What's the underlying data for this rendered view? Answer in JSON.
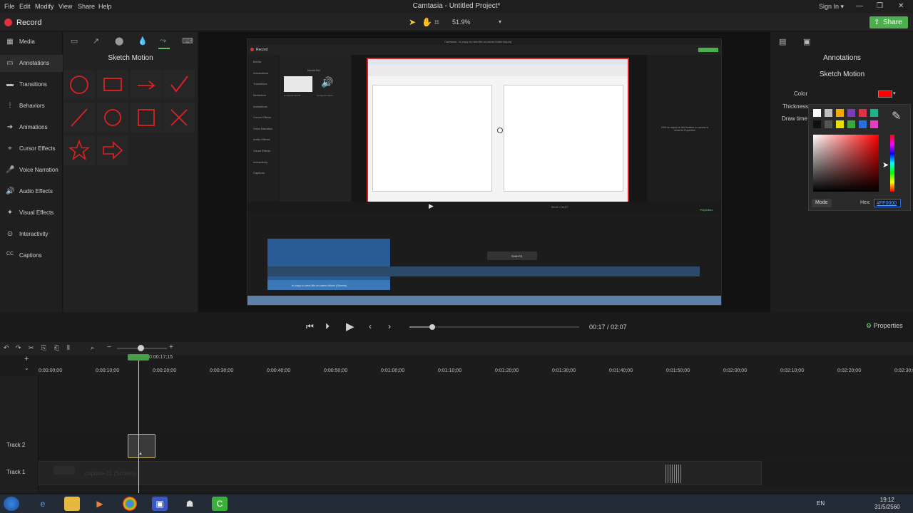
{
  "menu": [
    "File",
    "Edit",
    "Modify",
    "View",
    "Share",
    "Help"
  ],
  "app_title": "Camtasia - Untitled Project*",
  "signin": "Sign In ▾",
  "toolbar": {
    "record_label": "Record",
    "zoom": "51.9%",
    "zoom_caret": "▾",
    "share_label": "Share"
  },
  "sidebar": {
    "items": [
      {
        "label": "Media",
        "icon": "media-icon"
      },
      {
        "label": "Annotations",
        "icon": "annotations-icon"
      },
      {
        "label": "Transitions",
        "icon": "transitions-icon"
      },
      {
        "label": "Behaviors",
        "icon": "behaviors-icon"
      },
      {
        "label": "Animations",
        "icon": "animations-icon"
      },
      {
        "label": "Cursor Effects",
        "icon": "cursor-icon"
      },
      {
        "label": "Voice Narration",
        "icon": "mic-icon"
      },
      {
        "label": "Audio Effects",
        "icon": "speaker-icon"
      },
      {
        "label": "Visual Effects",
        "icon": "wand-icon"
      },
      {
        "label": "Interactivity",
        "icon": "interactivity-icon"
      },
      {
        "label": "Captions",
        "icon": "cc-icon"
      }
    ],
    "active": 1
  },
  "annotations_panel": {
    "title": "Sketch Motion",
    "stroke_color": "#e02020"
  },
  "right_panel": {
    "heading": "Annotations",
    "subheading": "Sketch Motion",
    "color_label": "Color",
    "thickness_label": "Thickness",
    "draw_time_label": "Draw time",
    "swatch_color": "#ff0000",
    "mode_label": "Mode",
    "hex_label": "Hex:",
    "hex_value": "#FF0000",
    "swatches_row1": [
      "#ffffff",
      "#bdbdbd",
      "#f2a900",
      "#7a3cb4",
      "#e0304a",
      "#1fb08c"
    ],
    "swatches_row2": [
      "#111111",
      "#555555",
      "#e8e000",
      "#3aa83a",
      "#2a6fe0",
      "#e040c0"
    ]
  },
  "playback": {
    "current": "00:17",
    "separator": "/",
    "total": "02:07",
    "properties_label": "Properties",
    "progress": 0.134
  },
  "timeline": {
    "playhead_time": "0:00:17;15",
    "ticks": [
      "0:00:00;00",
      "0:00:10;00",
      "0:00:20;00",
      "0:00:30;00",
      "0:00:40;00",
      "0:00:50;00",
      "0:01:00;00",
      "0:01:10;00",
      "0:01:20;00",
      "0:01:30;00",
      "0:01:40;00",
      "0:01:50;00",
      "0:02:00;00",
      "0:02:10;00",
      "0:02:20;00",
      "0:02:30;00"
    ],
    "tracks": [
      {
        "label": "Track 2"
      },
      {
        "label": "Track 1",
        "clip_label": "capture-21 (Screen)"
      }
    ]
  },
  "inner": {
    "title": "Camtasia - tc-copy-to-new-file-on-same-folder.tscproj",
    "record": "Record",
    "media_bin": "Media Bin",
    "clip_a": "tc-copy-to-new-fil...",
    "clip_b": "tc-copy-to-new-fi...",
    "selected_props_hint": "Click an object on the timeline or canvas to show its Properties",
    "sidebar": [
      "Media",
      "Annotations",
      "Transitions",
      "Behaviors",
      "Animations",
      "Cursor Effects",
      "Voice Narration",
      "Audio Effects",
      "Visual Effects",
      "Interactivity",
      "Captions"
    ],
    "track_clip_label": "tc-copy-to-new-file-on-same-folder (Screen)",
    "tooltip": "Shift+F5",
    "properties": "Properties",
    "time": "00:21 / 00:27"
  },
  "taskbar": {
    "lang": "EN",
    "time": "19:12",
    "date": "31/5/2560"
  }
}
